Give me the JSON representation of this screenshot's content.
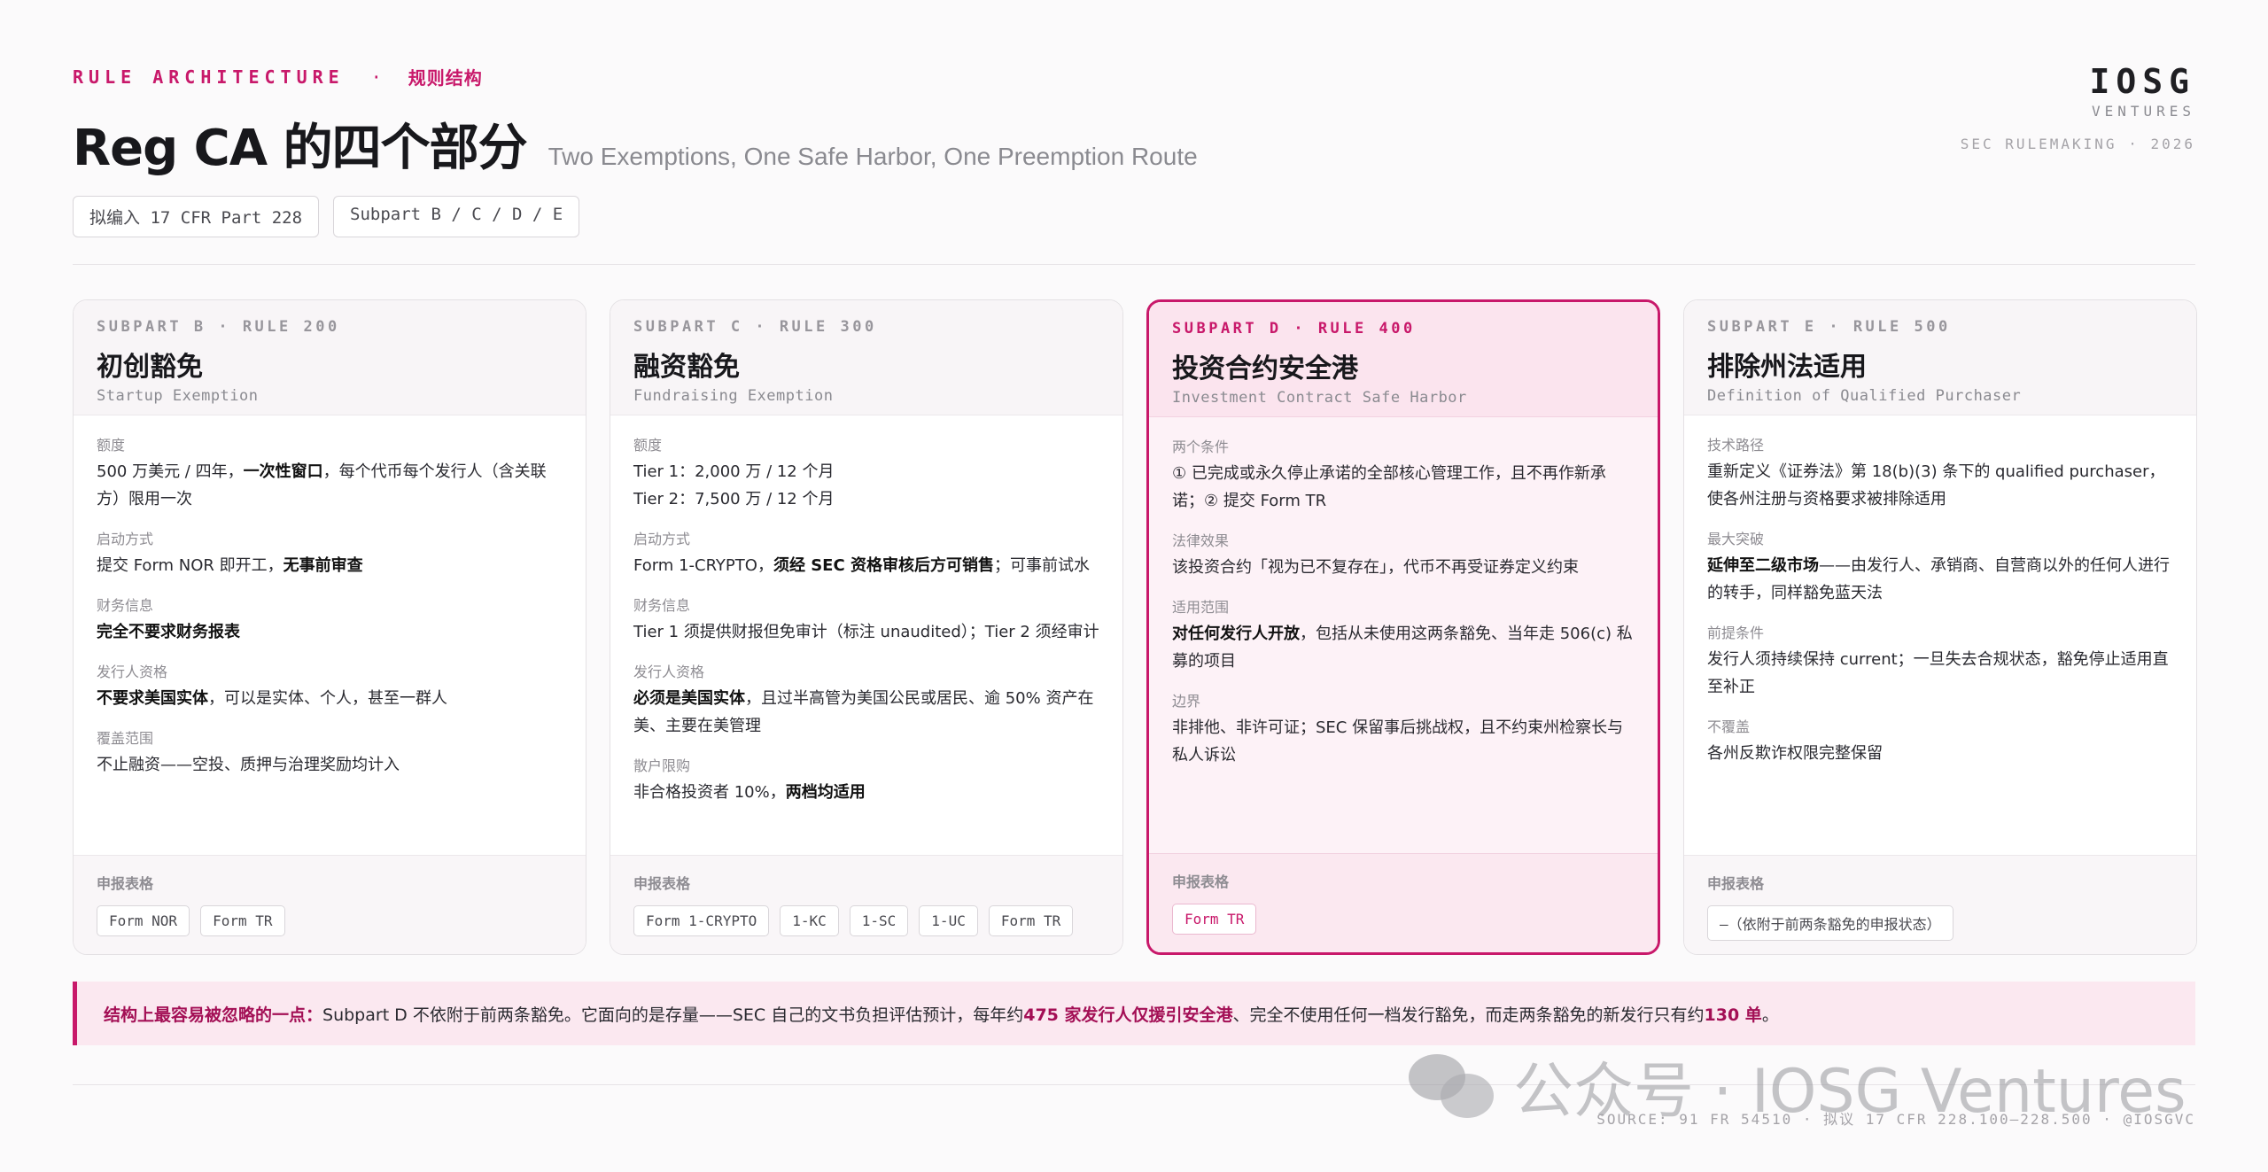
{
  "header": {
    "kicker_en": "RULE ARCHITECTURE",
    "kicker_sep": "·",
    "kicker_cn": "规则结构",
    "title": "Reg CA 的四个部分",
    "subtitle": "Two Exemptions, One Safe Harbor, One Preemption Route",
    "tags": [
      "拟编入 17 CFR Part 228",
      "Subpart B / C / D / E"
    ]
  },
  "brand": {
    "logo": "IOSG",
    "sub": "VENTURES",
    "meta": "SEC RULEMAKING · 2026"
  },
  "cards": [
    {
      "subpart": "SUBPART B · RULE 200",
      "name": "初创豁免",
      "name_en": "Startup Exemption",
      "fields": [
        {
          "label": "额度",
          "html": "500 万美元 / 四年，<b>一次性窗口</b>，每个代币每个发行人（含关联方）限用一次"
        },
        {
          "label": "启动方式",
          "html": "提交 Form NOR 即开工，<b>无事前审查</b>"
        },
        {
          "label": "财务信息",
          "html": "<b>完全不要求财务报表</b>"
        },
        {
          "label": "发行人资格",
          "html": "<b>不要求美国实体</b>，可以是实体、个人，甚至一群人"
        },
        {
          "label": "覆盖范围",
          "html": "不止融资——空投、质押与治理奖励均计入"
        }
      ],
      "forms_label": "申报表格",
      "forms": [
        "Form NOR",
        "Form TR"
      ]
    },
    {
      "subpart": "SUBPART C · RULE 300",
      "name": "融资豁免",
      "name_en": "Fundraising Exemption",
      "fields": [
        {
          "label": "额度",
          "html": "Tier 1：2,000 万 / 12 个月<br>Tier 2：7,500 万 / 12 个月"
        },
        {
          "label": "启动方式",
          "html": "Form 1-CRYPTO，<b>须经 SEC 资格审核后方可销售</b>；可事前试水"
        },
        {
          "label": "财务信息",
          "html": "Tier 1 须提供财报但免审计（标注 unaudited）；Tier 2 须经审计"
        },
        {
          "label": "发行人资格",
          "html": "<b>必须是美国实体</b>，且过半高管为美国公民或居民、逾 50% 资产在美、主要在美管理"
        },
        {
          "label": "散户限购",
          "html": "非合格投资者 10%，<b>两档均适用</b>"
        }
      ],
      "forms_label": "申报表格",
      "forms": [
        "Form 1-CRYPTO",
        "1-KC",
        "1-SC",
        "1-UC",
        "Form TR"
      ]
    },
    {
      "subpart": "SUBPART D · RULE 400",
      "name": "投资合约安全港",
      "name_en": "Investment Contract Safe Harbor",
      "fields": [
        {
          "label": "两个条件",
          "html": "① 已完成或永久停止承诺的全部核心管理工作，且不再作新承诺；② 提交 Form TR"
        },
        {
          "label": "法律效果",
          "html": "该投资合约「视为已不复存在」，代币不再受证券定义约束"
        },
        {
          "label": "适用范围",
          "html": "<b>对任何发行人开放</b>，包括从未使用这两条豁免、当年走 506(c) 私募的项目"
        },
        {
          "label": "边界",
          "html": "非排他、非许可证；SEC 保留事后挑战权，且不约束州检察长与私人诉讼"
        }
      ],
      "forms_label": "申报表格",
      "forms": [
        "Form TR"
      ]
    },
    {
      "subpart": "SUBPART E · RULE 500",
      "name": "排除州法适用",
      "name_en": "Definition of Qualified Purchaser",
      "fields": [
        {
          "label": "技术路径",
          "html": "重新定义《证券法》第 18(b)(3) 条下的 qualified purchaser，使各州注册与资格要求被排除适用"
        },
        {
          "label": "最大突破",
          "html": "<b>延伸至二级市场</b>——由发行人、承销商、自营商以外的任何人进行的转手，同样豁免蓝天法"
        },
        {
          "label": "前提条件",
          "html": "发行人须持续保持 current；一旦失去合规状态，豁免停止适用直至补正"
        },
        {
          "label": "不覆盖",
          "html": "各州反欺诈权限完整保留"
        }
      ],
      "forms_label": "申报表格",
      "forms": [
        "—（依附于前两条豁免的申报状态）"
      ]
    }
  ],
  "callout": {
    "lead": "结构上最容易被忽略的一点：",
    "t1": "Subpart D 不依附于前两条豁免。它面向的是存量——SEC 自己的文书负担评估预计，每年约 ",
    "b1": "475 家发行人仅援引安全港",
    "t2": "、完全不使用任何一档发行豁免，而走两条豁免的新发行只有约 ",
    "b2": "130 单",
    "t3": "。"
  },
  "source": "SOURCE: 91 FR 54510 · 拟议 17 CFR 228.100–228.500 · @IOSGVC",
  "watermark": "公众号 · IOSG Ventures",
  "colors": {
    "accent": "#c8186a",
    "background": "#fbfafb"
  }
}
